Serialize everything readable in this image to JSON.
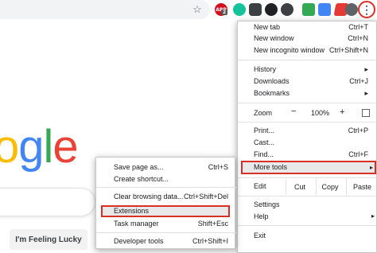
{
  "toolbar": {
    "abp_label": "ABP",
    "abp_badge": "2",
    "menu_dots": "⋮"
  },
  "page": {
    "logo_letters": [
      {
        "ch": "o",
        "color": "#fbbc05"
      },
      {
        "ch": "g",
        "color": "#4285f4"
      },
      {
        "ch": "l",
        "color": "#34a853"
      },
      {
        "ch": "e",
        "color": "#ea4335"
      }
    ],
    "lucky_label": "I'm Feeling Lucky"
  },
  "menu": {
    "new_tab": {
      "label": "New tab",
      "shortcut": "Ctrl+T"
    },
    "new_window": {
      "label": "New window",
      "shortcut": "Ctrl+N"
    },
    "incognito": {
      "label": "New incognito window",
      "shortcut": "Ctrl+Shift+N"
    },
    "history": {
      "label": "History"
    },
    "downloads": {
      "label": "Downloads",
      "shortcut": "Ctrl+J"
    },
    "bookmarks": {
      "label": "Bookmarks"
    },
    "zoom": {
      "label": "Zoom",
      "minus": "−",
      "value": "100%",
      "plus": "+"
    },
    "print": {
      "label": "Print...",
      "shortcut": "Ctrl+P"
    },
    "cast": {
      "label": "Cast..."
    },
    "find": {
      "label": "Find...",
      "shortcut": "Ctrl+F"
    },
    "more_tools": {
      "label": "More tools"
    },
    "edit": {
      "label": "Edit",
      "cut": "Cut",
      "copy": "Copy",
      "paste": "Paste"
    },
    "settings": {
      "label": "Settings"
    },
    "help": {
      "label": "Help"
    },
    "exit": {
      "label": "Exit"
    }
  },
  "submenu": {
    "save_page": {
      "label": "Save page as...",
      "shortcut": "Ctrl+S"
    },
    "create_shortcut": {
      "label": "Create shortcut..."
    },
    "clear_data": {
      "label": "Clear browsing data...",
      "shortcut": "Ctrl+Shift+Del"
    },
    "extensions": {
      "label": "Extensions"
    },
    "task_manager": {
      "label": "Task manager",
      "shortcut": "Shift+Esc"
    },
    "dev_tools": {
      "label": "Developer tools",
      "shortcut": "Ctrl+Shift+I"
    }
  },
  "colors": {
    "highlight_border": "#d93025",
    "hover_background": "#e8e8e8"
  }
}
